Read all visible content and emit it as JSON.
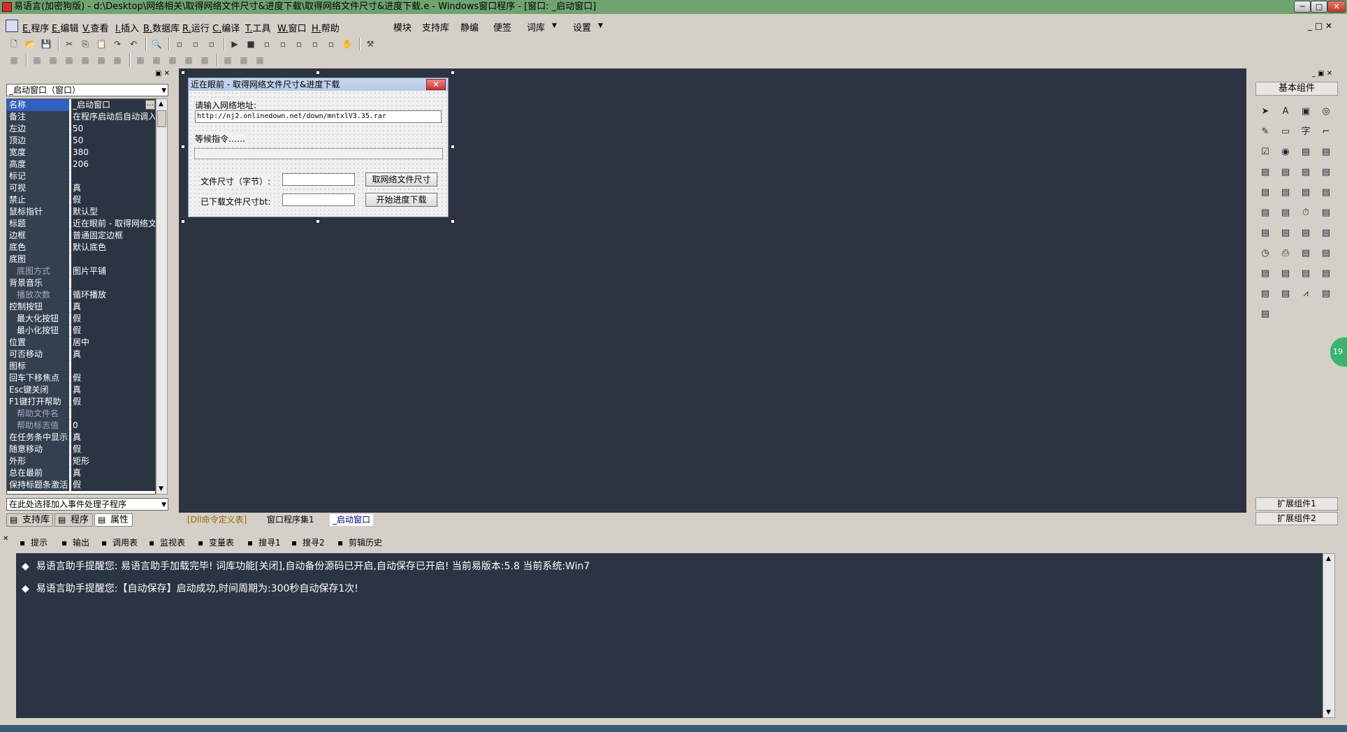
{
  "window": {
    "title": "易语言(加密狗版) - d:\\Desktop\\网络相关\\取得网络文件尺寸&进度下载\\取得网络文件尺寸&进度下载.e - Windows窗口程序 - [窗口: _启动窗口]",
    "min": "─",
    "max": "□",
    "close": "✕"
  },
  "menu": {
    "items": [
      {
        "key": "E.",
        "label": "程序"
      },
      {
        "key": "E.",
        "label": "编辑"
      },
      {
        "key": "V.",
        "label": "查看"
      },
      {
        "key": "I.",
        "label": "插入"
      },
      {
        "key": "B.",
        "label": "数据库"
      },
      {
        "key": "R.",
        "label": "运行"
      },
      {
        "key": "C.",
        "label": "编译"
      },
      {
        "key": "T.",
        "label": "工具"
      },
      {
        "key": "W.",
        "label": "窗口"
      },
      {
        "key": "H.",
        "label": "帮助"
      }
    ],
    "extra": [
      "模块",
      "支持库",
      "静编",
      "便签",
      "词库",
      "设置"
    ]
  },
  "left_panel": {
    "object_combo": "_启动窗口（窗口）",
    "properties": [
      {
        "name": "名称",
        "value": "_启动窗口",
        "selected": true
      },
      {
        "name": "备注",
        "value": "在程序启动后自动调入"
      },
      {
        "name": "左边",
        "value": "50"
      },
      {
        "name": "顶边",
        "value": "50"
      },
      {
        "name": "宽度",
        "value": "380"
      },
      {
        "name": "高度",
        "value": "206"
      },
      {
        "name": "标记",
        "value": ""
      },
      {
        "name": "可视",
        "value": "真"
      },
      {
        "name": "禁止",
        "value": "假"
      },
      {
        "name": "鼠标指针",
        "value": "默认型"
      },
      {
        "name": "标题",
        "value": "近在眼前 - 取得网络文"
      },
      {
        "name": "边框",
        "value": "普通固定边框"
      },
      {
        "name": "底色",
        "value": "默认底色"
      },
      {
        "name": "底图",
        "value": ""
      },
      {
        "name": "底图方式",
        "value": "图片平铺",
        "sub": true
      },
      {
        "name": "背景音乐",
        "value": ""
      },
      {
        "name": "播放次数",
        "value": "循环播放",
        "sub": true
      },
      {
        "name": "控制按钮",
        "value": "真"
      },
      {
        "name": "最大化按钮",
        "value": "假",
        "indent": true
      },
      {
        "name": "最小化按钮",
        "value": "假",
        "indent": true
      },
      {
        "name": "位置",
        "value": "居中"
      },
      {
        "name": "可否移动",
        "value": "真"
      },
      {
        "name": "图标",
        "value": ""
      },
      {
        "name": "回车下移焦点",
        "value": "假"
      },
      {
        "name": "Esc键关闭",
        "value": "真"
      },
      {
        "name": "F1键打开帮助",
        "value": "假"
      },
      {
        "name": "帮助文件名",
        "value": "",
        "sub": true
      },
      {
        "name": "帮助标志值",
        "value": "0",
        "sub": true
      },
      {
        "name": "在任务条中显示",
        "value": "真"
      },
      {
        "name": "随意移动",
        "value": "假"
      },
      {
        "name": "外形",
        "value": "矩形"
      },
      {
        "name": "总在最前",
        "value": "真"
      },
      {
        "name": "保持标题条激活",
        "value": "假"
      }
    ],
    "event_combo": "在此处选择加入事件处理子程序",
    "tabs": [
      "支持库",
      "程序",
      "属性"
    ]
  },
  "form": {
    "title": "近在眼前 - 取得网络文件尺寸&进度下载",
    "url_label": "请输入网络地址:",
    "url_value": "http://nj2.onlinedown.net/down/mntxlV3.35.rar",
    "status_label": "等候指令……",
    "size_label": "文件尺寸（字节）:",
    "size_button": "取网络文件尺寸",
    "downloaded_label": "已下载文件尺寸bt:",
    "download_button": "开始进度下载",
    "close": "✕"
  },
  "canvas_tabs": [
    "[Dll命令定义表]",
    "窗口程序集1",
    "_启动窗口"
  ],
  "right_panel": {
    "title": "基本组件",
    "extensions": [
      "扩展组件1",
      "扩展组件2"
    ],
    "icons": [
      "pointer-icon",
      "label-icon",
      "picture-icon",
      "frame-icon",
      "edit-icon",
      "button-icon",
      "char-icon",
      "line-icon",
      "checkbox-icon",
      "radio-icon",
      "combobox-icon",
      "listbox-icon",
      "listview-icon",
      "scrollbar-icon",
      "slider-icon",
      "progress-icon",
      "tab-icon",
      "panel-icon",
      "treeview-icon",
      "calendar-icon",
      "grid-icon",
      "status-icon",
      "timer-icon",
      "dialog-icon",
      "table-icon",
      "database-icon",
      "spin-icon",
      "toolbar-icon",
      "clock-icon",
      "printer-icon",
      "network-icon",
      "network2-icon",
      "client-icon",
      "server-icon",
      "window-icon",
      "window2-icon",
      "tree2-icon",
      "db2-icon",
      "chart-icon",
      "odbc-icon",
      "odbc2-icon"
    ]
  },
  "output_tabs": [
    "提示",
    "输出",
    "调用表",
    "监视表",
    "变量表",
    "搜寻1",
    "搜寻2",
    "剪辑历史"
  ],
  "output": {
    "messages": [
      "易语言助手提醒您:  易语言助手加载完毕!  词库功能[关闭],自动备份源码已开启,自动保存已开启!  当前易版本:5.8  当前系统:Win7",
      "易语言助手提醒您:【自动保存】启动成功,时间周期为:300秒自动保存1次!"
    ]
  },
  "side_badge": "19",
  "colors": {
    "canvas": "#2d3340",
    "output_bg": "#2b3443",
    "titlebar": "#6fa36f"
  }
}
